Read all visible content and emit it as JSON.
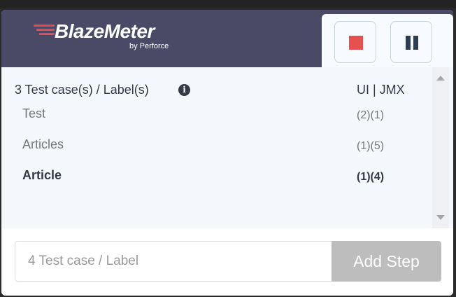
{
  "brand": {
    "name": "BlazeMeter",
    "tagline": "by Perforce",
    "color": "#e34a52"
  },
  "controls": {
    "stop_icon": "stop-icon",
    "pause_icon": "pause-icon",
    "stop_color": "#e55050",
    "pause_color": "#2c3d55"
  },
  "list": {
    "title": "3 Test case(s) / Label(s)",
    "info_icon": "info-icon",
    "columns_header": "UI | JMX",
    "items": [
      {
        "label": "Test",
        "counts": "(2)(1)",
        "active": false
      },
      {
        "label": "Articles",
        "counts": "(1)(5)",
        "active": false
      },
      {
        "label": "Article",
        "counts": "(1)(4)",
        "active": true
      }
    ]
  },
  "footer": {
    "input_placeholder": "4 Test case / Label",
    "input_value": "",
    "add_button": "Add Step"
  }
}
